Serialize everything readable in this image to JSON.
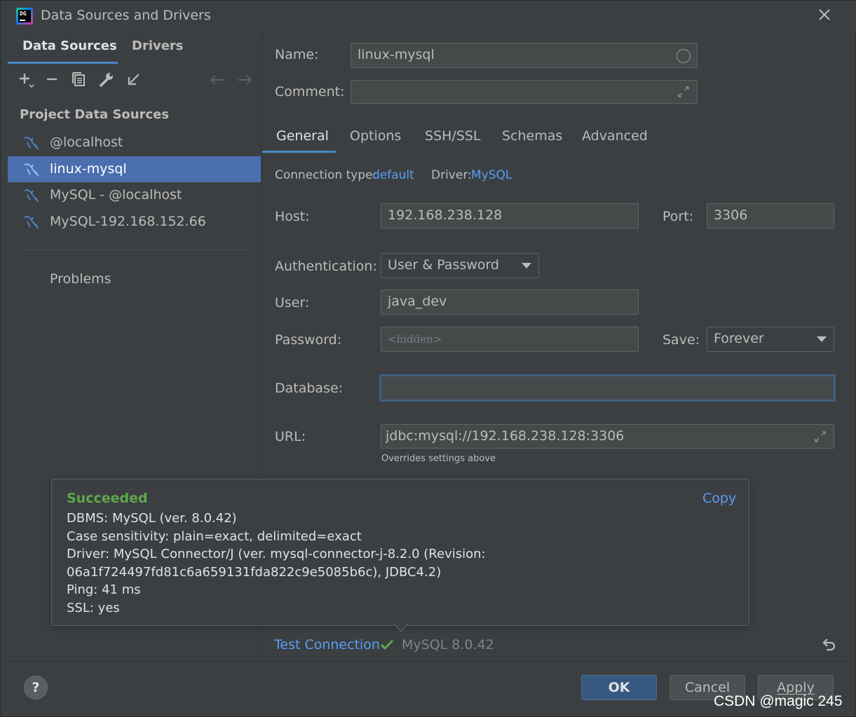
{
  "window": {
    "title": "Data Sources and Drivers",
    "logo_text": "DG"
  },
  "left": {
    "tabs": [
      "Data Sources",
      "Drivers"
    ],
    "section_title": "Project Data Sources",
    "items": [
      {
        "label": "@localhost"
      },
      {
        "label": "linux-mysql",
        "selected": true
      },
      {
        "label": "MySQL - @localhost"
      },
      {
        "label": "MySQL-192.168.152.66"
      }
    ],
    "problems_label": "Problems",
    "toolbar_icons": [
      "add-icon",
      "remove-icon",
      "duplicate-icon",
      "wrench-icon",
      "import-icon",
      "back-arrow-icon",
      "forward-arrow-icon"
    ]
  },
  "form": {
    "name_label": "Name:",
    "name_value": "linux-mysql",
    "comment_label": "Comment:",
    "comment_value": "",
    "tabs": [
      "General",
      "Options",
      "SSH/SSL",
      "Schemas",
      "Advanced"
    ],
    "connection_type_label": "Connection type:",
    "connection_type_value": "default",
    "driver_label": "Driver:",
    "driver_value": "MySQL",
    "host_label": "Host:",
    "host_value": "192.168.238.128",
    "port_label": "Port:",
    "port_value": "3306",
    "auth_label": "Authentication:",
    "auth_value": "User & Password",
    "user_label": "User:",
    "user_value": "java_dev",
    "password_label": "Password:",
    "password_placeholder": "<hidden>",
    "save_label": "Save:",
    "save_value": "Forever",
    "database_label": "Database:",
    "database_value": "",
    "url_label": "URL:",
    "url_value": "jdbc:mysql://192.168.238.128:3306",
    "url_hint": "Overrides settings above"
  },
  "popup": {
    "status": "Succeeded",
    "copy_label": "Copy",
    "lines": [
      "DBMS: MySQL (ver. 8.0.42)",
      "Case sensitivity: plain=exact, delimited=exact",
      "Driver: MySQL Connector/J (ver. mysql-connector-j-8.2.0 (Revision:",
      "06a1f724497fd81c6a659131fda822c9e5085b6c), JDBC4.2)",
      "Ping: 41 ms",
      "SSL: yes"
    ]
  },
  "test": {
    "link_label": "Test Connection",
    "result": "MySQL 8.0.42"
  },
  "buttons": {
    "help": "?",
    "ok": "OK",
    "cancel": "Cancel",
    "apply": "Apply"
  },
  "watermark": "CSDN @magic 245",
  "colors": {
    "accent": "#4a88c7",
    "selection": "#4b6eaf",
    "link": "#589df6",
    "success": "#5ea84f",
    "background": "#3c3f41"
  }
}
